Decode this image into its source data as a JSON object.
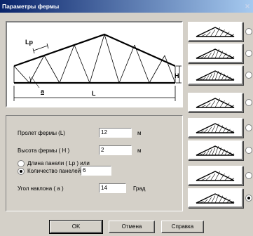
{
  "window": {
    "title": "Параметры фермы"
  },
  "diagram": {
    "label_lp": "Lp",
    "label_a": "a",
    "label_h": "H",
    "label_l": "L"
  },
  "form": {
    "span_label": "Пролет фермы (L)",
    "span_value": "12",
    "span_unit": "м",
    "height_label": "Высота фермы ( H )",
    "height_value": "2",
    "height_unit": "м",
    "panel_length_label": "Длина панели ( Lp ) или",
    "panel_count_label": "Количество панелей",
    "panel_count_value": "6",
    "angle_label": "Угол наклона ( a )",
    "angle_value": "14",
    "angle_unit": "Град",
    "selected_mode": "panel_count"
  },
  "truss_types": {
    "count": 8,
    "selected_index": 7
  },
  "buttons": {
    "ok": "OK",
    "cancel": "Отмена",
    "help": "Справка"
  }
}
